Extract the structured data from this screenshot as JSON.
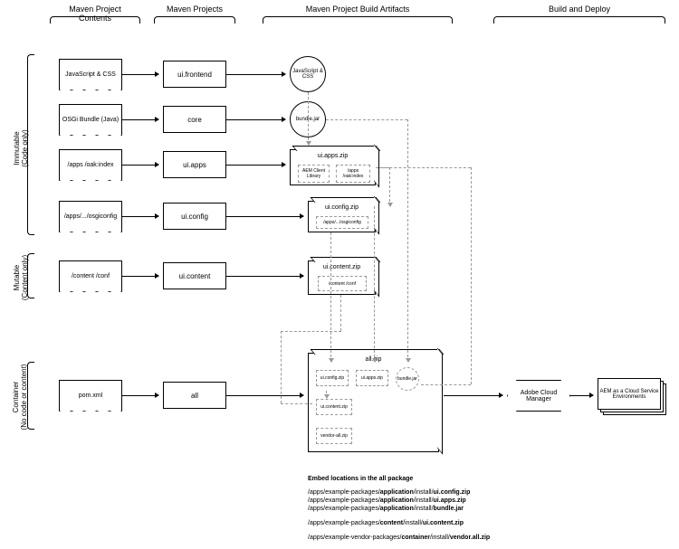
{
  "columns": {
    "contents": "Maven Project Contents",
    "projects": "Maven Projects",
    "artifacts": "Maven Project Build Artifacts",
    "deploy": "Build and Deploy"
  },
  "rows": {
    "immutable": "Immutable\n(Code only)",
    "mutable": "Mutable\n(Content only)",
    "container": "Container\n(No code or content)"
  },
  "contents": {
    "jscss": "JavaScript & CSS",
    "osgi": "OSGi Bundle (Java)",
    "apps": "/apps /oak:index",
    "config": "/apps/.../osgiconfig",
    "content": "/content /conf",
    "pom": "pom.xml"
  },
  "projects": {
    "frontend": "ui.frontend",
    "core": "core",
    "apps": "ui.apps",
    "config": "ui.config",
    "content": "ui.content",
    "all": "all"
  },
  "artifacts": {
    "jscss": "JavaScript & CSS",
    "bundle": "bundle.jar",
    "apps_zip": "ui.apps.zip",
    "apps_clientlib": "AEM Client Library",
    "apps_oak": "/apps /oak:index",
    "config_zip": "ui.config.zip",
    "config_inner": "/apps/.../osgiconfig",
    "content_zip": "ui.content.zip",
    "content_inner": "/content /conf",
    "all_zip": "all.zip",
    "all_config": "ui.config.zip",
    "all_apps": "ui.apps.zip",
    "all_bundle": "bundle.jar",
    "all_content": "ui.content.zip",
    "all_vendor": "vendor-all.zip"
  },
  "deploy": {
    "acm": "Adobe Cloud Manager",
    "envs": "AEM as a Cloud Service Environments"
  },
  "footer": {
    "title": "Embed locations in the all package",
    "l1a": "/apps/example-packages/",
    "l1b": "application",
    "l1c": "/install/",
    "l1d": "ui.config.zip",
    "l2a": "/apps/example-packages/",
    "l2b": "application",
    "l2c": "/install/",
    "l2d": "ui.apps.zip",
    "l3a": "/apps/example-packages/",
    "l3b": "application",
    "l3c": "/install/",
    "l3d": "bundle.jar",
    "l4a": "/apps/example-packages/",
    "l4b": "content",
    "l4c": "/install/",
    "l4d": "ui.content.zip",
    "l5a": "/apps/example-vendor-packages/",
    "l5b": "container",
    "l5c": "/install/",
    "l5d": "vendor.all.zip"
  }
}
